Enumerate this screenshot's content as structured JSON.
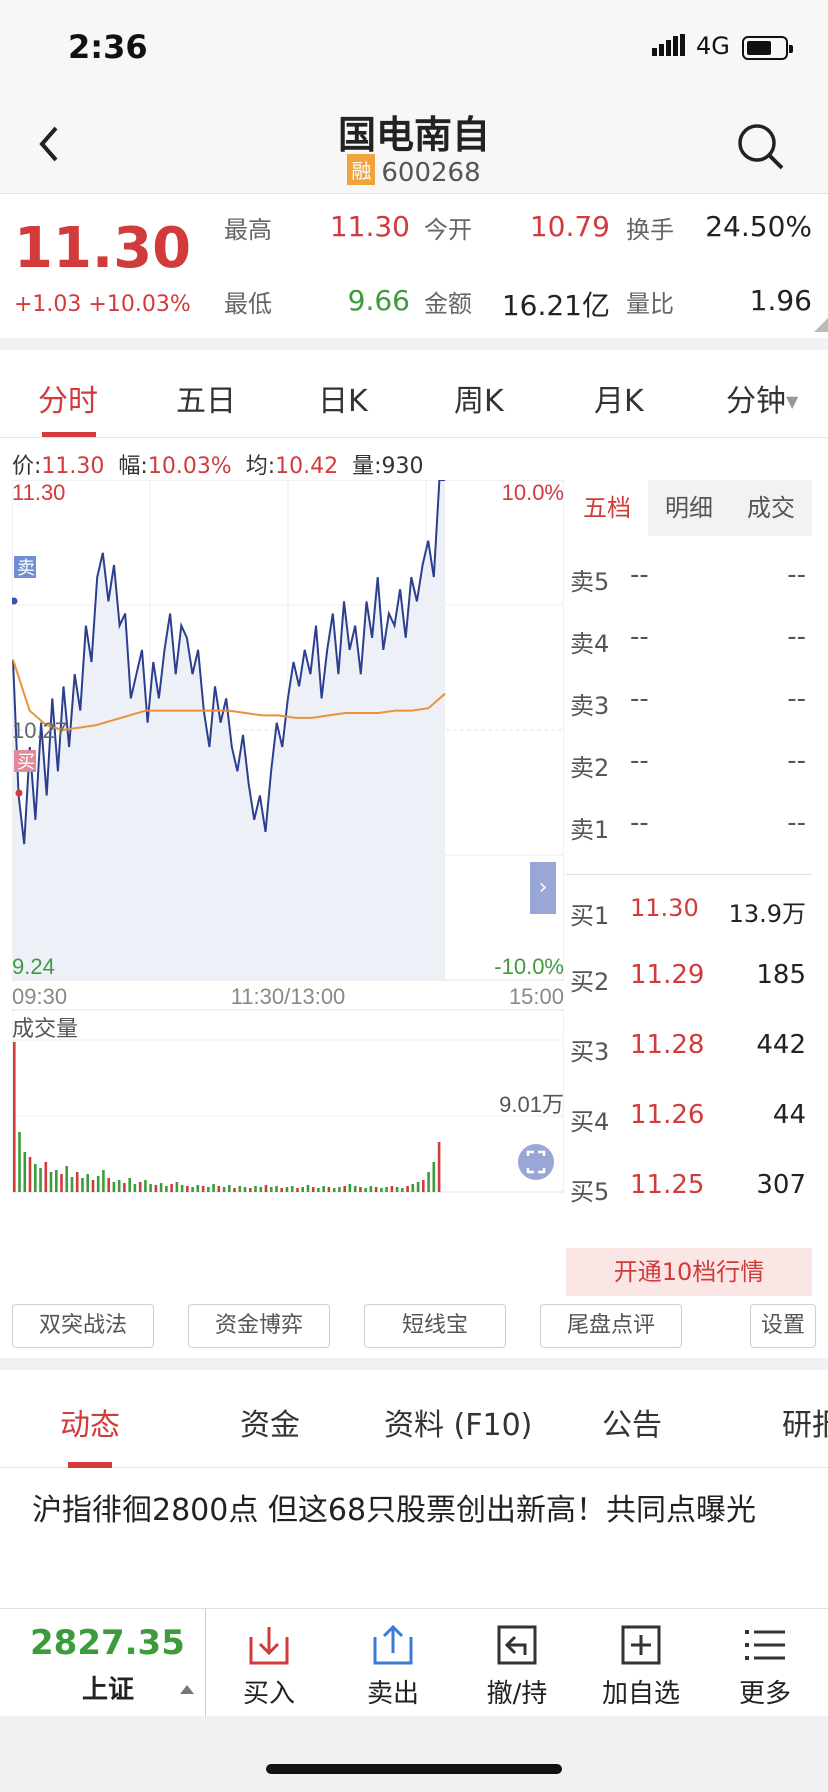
{
  "status_bar": {
    "time": "2:36",
    "network": "4G"
  },
  "header": {
    "title": "国电南自",
    "badge": "融",
    "code": "600268"
  },
  "quote": {
    "price": "11.30",
    "change": "+1.03",
    "change_pct": "+10.03%",
    "fields": [
      {
        "label": "最高",
        "value": "11.30",
        "color": "red"
      },
      {
        "label": "今开",
        "value": "10.79",
        "color": "red"
      },
      {
        "label": "换手",
        "value": "24.50%",
        "color": "black"
      },
      {
        "label": "最低",
        "value": "9.66",
        "color": "green"
      },
      {
        "label": "金额",
        "value": "16.21亿",
        "color": "black"
      },
      {
        "label": "量比",
        "value": "1.96",
        "color": "black"
      }
    ]
  },
  "period_tabs": [
    "分时",
    "五日",
    "日K",
    "周K",
    "月K",
    "分钟"
  ],
  "active_period": "分时",
  "info_line": {
    "price_label": "价:",
    "price": "11.30",
    "amp_label": "幅:",
    "amp": "10.03%",
    "avg_label": "均:",
    "avg": "10.42",
    "vol_label": "量:",
    "vol": "930"
  },
  "chart_labels": {
    "top_price": "11.30",
    "top_pct": "10.0%",
    "mid_price": "10.27",
    "bottom_price": "9.24",
    "bottom_pct": "-10.0%",
    "time_start": "09:30",
    "time_mid": "11:30/13:00",
    "time_end": "15:00",
    "sell_marker": "卖",
    "buy_marker": "买",
    "volume_title": "成交量",
    "volume_max": "9.01万"
  },
  "order_book": {
    "tabs": [
      "五档",
      "明细",
      "成交"
    ],
    "asks": [
      {
        "label": "卖5",
        "price": "--",
        "vol": "--"
      },
      {
        "label": "卖4",
        "price": "--",
        "vol": "--"
      },
      {
        "label": "卖3",
        "price": "--",
        "vol": "--"
      },
      {
        "label": "卖2",
        "price": "--",
        "vol": "--"
      },
      {
        "label": "卖1",
        "price": "--",
        "vol": "--"
      }
    ],
    "bids": [
      {
        "label": "买1",
        "price": "11.30",
        "vol": "13.9万"
      },
      {
        "label": "买2",
        "price": "11.29",
        "vol": "185"
      },
      {
        "label": "买3",
        "price": "11.28",
        "vol": "442"
      },
      {
        "label": "买4",
        "price": "11.26",
        "vol": "44"
      },
      {
        "label": "买5",
        "price": "11.25",
        "vol": "307"
      }
    ],
    "upgrade": "开通10档行情"
  },
  "tool_buttons": [
    "双突战法",
    "资金博弈",
    "短线宝",
    "尾盘点评",
    "设置"
  ],
  "lower_tabs": [
    "动态",
    "资金",
    "资料 (F10)",
    "公告",
    "研报"
  ],
  "news": "沪指徘徊2800点 但这68只股票创出新高！共同点曝光",
  "bottom_bar": {
    "index_value": "2827.35",
    "index_name": "上证",
    "actions": [
      "买入",
      "卖出",
      "撤/持",
      "加自选",
      "更多"
    ]
  },
  "chart_data": {
    "type": "line",
    "x_start": "09:30",
    "x_end": "15:00",
    "ylim": [
      9.24,
      11.3
    ],
    "series": [
      {
        "values": [
          10.56,
          10.0,
          9.8,
          10.2,
          9.9,
          10.3,
          10.0,
          10.4,
          10.1,
          10.45,
          10.2,
          10.5,
          10.35,
          10.7,
          10.55,
          10.9,
          11.0,
          10.8,
          10.95,
          10.7,
          10.75,
          10.4,
          10.5,
          10.6,
          10.3,
          10.55,
          10.4,
          10.6,
          10.75,
          10.5,
          10.7,
          10.65,
          10.5,
          10.6,
          10.35,
          10.2,
          10.45,
          10.3,
          10.4,
          10.2,
          10.1,
          10.25,
          10.05,
          9.9,
          10.0,
          9.85,
          10.1,
          10.3,
          10.2,
          10.4,
          10.55,
          10.45,
          10.6,
          10.5,
          10.7,
          10.4,
          10.6,
          10.75,
          10.5,
          10.8,
          10.6,
          10.7,
          10.5,
          10.8,
          10.65,
          10.9,
          10.6,
          10.75,
          10.7,
          10.85,
          10.65,
          10.9,
          10.8,
          10.95,
          11.05,
          10.9,
          11.3,
          11.3
        ]
      },
      {
        "values": [
          10.56,
          10.35,
          10.29,
          10.27,
          10.28,
          10.29,
          10.31,
          10.33,
          10.35,
          10.35,
          10.35,
          10.35,
          10.35,
          10.35,
          10.34,
          10.33,
          10.33,
          10.32,
          10.32,
          10.33,
          10.34,
          10.34,
          10.34,
          10.35,
          10.35,
          10.36,
          10.42
        ]
      }
    ],
    "volume": {
      "max": "9.01万"
    }
  }
}
